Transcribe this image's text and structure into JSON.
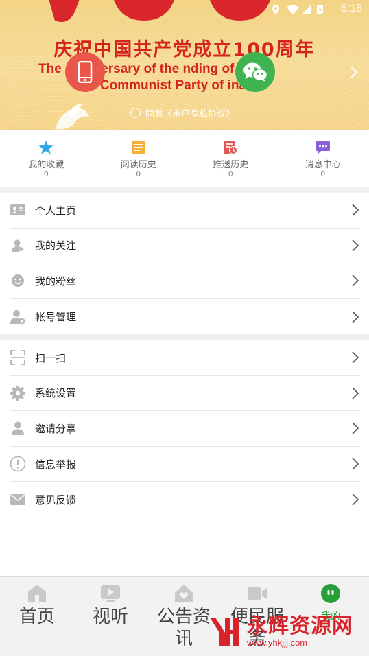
{
  "status_bar": {
    "time": "6:18"
  },
  "banner": {
    "title_cn": "庆祝中国共产党成立100周年",
    "title_en_line1": "The      Anniversary of the      nding of",
    "title_en_line2": "e Communist Party of     ina",
    "agree_text": "同意《用户隐私协议》",
    "accent_color": "#d4241e"
  },
  "quick_links": [
    {
      "label": "我的收藏",
      "count": "0",
      "icon": "star-icon"
    },
    {
      "label": "阅读历史",
      "count": "0",
      "icon": "document-icon"
    },
    {
      "label": "推送历史",
      "count": "0",
      "icon": "clock-document-icon"
    },
    {
      "label": "消息中心",
      "count": "0",
      "icon": "chat-bubble-icon"
    }
  ],
  "menu_section_1": [
    {
      "label": "个人主页",
      "icon": "id-card-icon"
    },
    {
      "label": "我的关注",
      "icon": "user-star-icon"
    },
    {
      "label": "我的粉丝",
      "icon": "smiley-icon"
    },
    {
      "label": "帐号管理",
      "icon": "user-gear-icon"
    }
  ],
  "menu_section_2": [
    {
      "label": "扫一扫",
      "icon": "scan-icon"
    },
    {
      "label": "系统设置",
      "icon": "gear-icon"
    },
    {
      "label": "邀请分享",
      "icon": "user-icon"
    },
    {
      "label": "信息举报",
      "icon": "exclamation-icon"
    },
    {
      "label": "意见反馈",
      "icon": "envelope-icon"
    }
  ],
  "tabs": [
    {
      "label": "首页",
      "icon": "home-icon"
    },
    {
      "label": "视听",
      "icon": "play-icon"
    },
    {
      "label": "公告资讯",
      "icon": "house-heart-icon"
    },
    {
      "label": "便民服务",
      "icon": "camera-icon"
    },
    {
      "label": "我的",
      "icon": "user-face-icon"
    }
  ],
  "watermark": {
    "brand": "永辉资源网",
    "url": "www.yhkjjj.com"
  }
}
